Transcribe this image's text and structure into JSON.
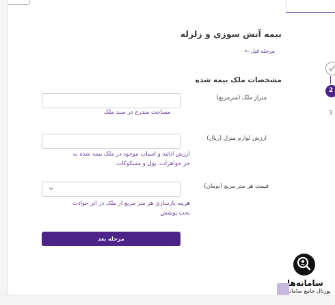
{
  "page": {
    "title": "بیمه آتش سوزی و زلزله",
    "back_label": "مرحله قبل",
    "section_title": "مشخصات ملک بیمه شده"
  },
  "form": {
    "area": {
      "label": "متراژ ملک (مترمربع)",
      "value": "",
      "hint": "مساحت مندرج در سند ملک"
    },
    "furniture_value": {
      "label": "ارزش لوازم منزل (ریال)",
      "value": "",
      "hint_line1": "ارزش اثاثیه و اسباب موجود در ملک بیمه شده به",
      "hint_line2": "جز جواهرات، پول و مسکوکات"
    },
    "price_per_meter": {
      "label": "قیمت هر متر مربع (تومان)",
      "selected": "",
      "hint_line1": "هزینه بازسازی هر متر مربع از ملک در اثر حوادث",
      "hint_line2": "تحت پوشش"
    },
    "next_label": "مرحله بعد"
  },
  "steps": {
    "step2": "2",
    "step3": "3"
  },
  "watermark": {
    "name": "سامانه‌ها",
    "tagline": "پورتال جامع سامانه‌ها"
  },
  "colors": {
    "accent": "#4b2389",
    "hint": "#6b3fa0"
  }
}
